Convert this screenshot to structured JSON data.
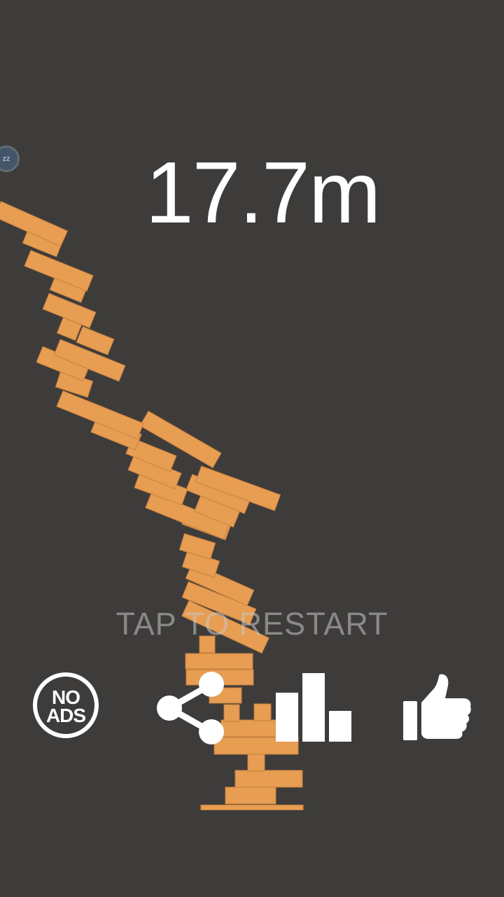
{
  "game": {
    "score": "17.7m",
    "restart_prompt": "TAP TO RESTART",
    "player_badge": "zz"
  },
  "buttons": {
    "no_ads_line1": "NO",
    "no_ads_line2": "ADS"
  },
  "icons": {
    "share": "share-icon",
    "leaderboard": "leaderboard-icon",
    "like": "thumbs-up-icon"
  },
  "colors": {
    "background": "#3e3c3b",
    "block": "#e79d52",
    "block_edge": "#c7803e",
    "text": "#ffffff",
    "prompt": "#a9a9a9"
  }
}
